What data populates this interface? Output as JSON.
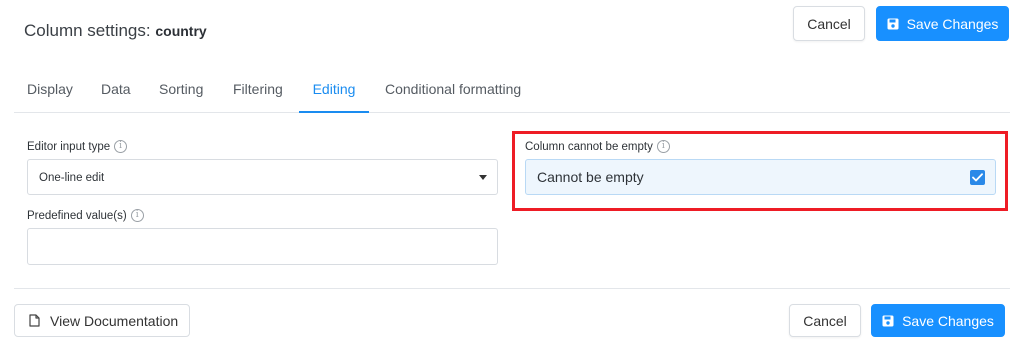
{
  "header": {
    "title_prefix": "Column settings:",
    "column_name": "country",
    "cancel_label": "Cancel",
    "save_label": "Save Changes"
  },
  "tabs": [
    {
      "label": "Display",
      "active": false
    },
    {
      "label": "Data",
      "active": false
    },
    {
      "label": "Sorting",
      "active": false
    },
    {
      "label": "Filtering",
      "active": false
    },
    {
      "label": "Editing",
      "active": true
    },
    {
      "label": "Conditional formatting",
      "active": false
    }
  ],
  "editing": {
    "editor_input_type_label": "Editor input type",
    "editor_input_type_value": "One-line edit",
    "predefined_values_label": "Predefined value(s)",
    "predefined_values_value": "",
    "cannot_be_empty_label": "Column cannot be empty",
    "cannot_be_empty_text": "Cannot be empty",
    "cannot_be_empty_checked": true
  },
  "footer": {
    "view_docs_label": "View Documentation",
    "cancel_label": "Cancel",
    "save_label": "Save Changes"
  },
  "colors": {
    "accent": "#1890ff",
    "highlight": "#ee1c25",
    "checkbox": "#2a89e8"
  },
  "icons": {
    "save": "floppy-disk-icon",
    "info": "info-icon",
    "document": "document-icon",
    "dropdown": "caret-down-icon",
    "check": "check-icon"
  }
}
